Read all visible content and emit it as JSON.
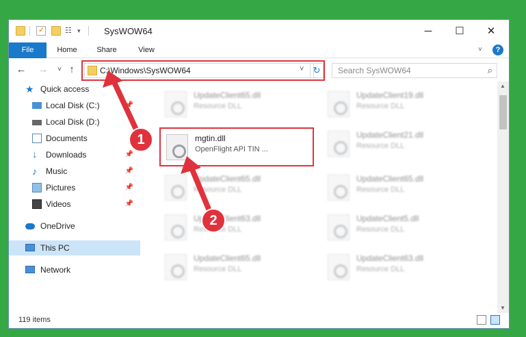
{
  "window": {
    "title": "SysWOW64"
  },
  "ribbon": {
    "tabs": [
      "File",
      "Home",
      "Share",
      "View"
    ]
  },
  "address": {
    "path": "C:\\Windows\\SysWOW64"
  },
  "search": {
    "placeholder": "Search SysWOW64"
  },
  "nav": {
    "items": [
      {
        "label": "Quick access"
      },
      {
        "label": "Local Disk (C:)"
      },
      {
        "label": "Local Disk (D:)"
      },
      {
        "label": "Documents"
      },
      {
        "label": "Downloads"
      },
      {
        "label": "Music"
      },
      {
        "label": "Pictures"
      },
      {
        "label": "Videos"
      },
      {
        "label": "OneDrive"
      },
      {
        "label": "This PC"
      },
      {
        "label": "Network"
      }
    ]
  },
  "files": {
    "left": [
      {
        "name": "UpdateClient65.dll",
        "desc": "Resource DLL"
      },
      {
        "name": "UpdateClient65.dll",
        "desc": "Resource DLL"
      },
      {
        "name": "UpdateClient63.dll",
        "desc": "Resource DLL"
      },
      {
        "name": "UpdateClient65.dll",
        "desc": "Resource DLL"
      }
    ],
    "right": [
      {
        "name": "UpdateClient19.dll",
        "desc": "Resource DLL"
      },
      {
        "name": "UpdateClient21.dll",
        "desc": "Resource DLL"
      },
      {
        "name": "UpdateClient65.dll",
        "desc": "Resource DLL"
      },
      {
        "name": "UpdateClient5.dll",
        "desc": "Resource DLL"
      },
      {
        "name": "UpdateClient63.dll",
        "desc": "Resource DLL"
      }
    ],
    "highlight": {
      "name": "mgtin.dll",
      "desc": "OpenFlight API TIN ..."
    }
  },
  "status": {
    "count": "119 items"
  },
  "markers": [
    "1",
    "2"
  ],
  "colors": {
    "accent": "#1979ca",
    "highlight": "#e0323c",
    "background": "#35a845"
  }
}
